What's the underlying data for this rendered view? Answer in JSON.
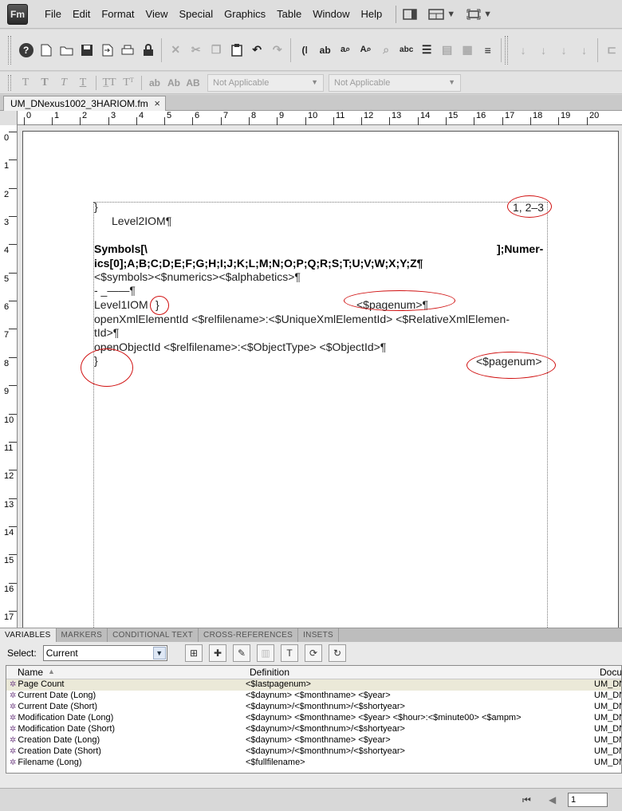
{
  "menubar": {
    "logo": "Fm",
    "items": [
      "File",
      "Edit",
      "Format",
      "View",
      "Special",
      "Graphics",
      "Table",
      "Window",
      "Help"
    ]
  },
  "toolbar2": {
    "dropdown1": "Not Applicable",
    "dropdown2": "Not Applicable"
  },
  "document_tab": {
    "filename": "UM_DNexus1002_3HARIOM.fm",
    "close": "×"
  },
  "ruler": {
    "h_labels": [
      "0",
      "1",
      "2",
      "3",
      "4",
      "5",
      "6",
      "7",
      "8",
      "9",
      "10",
      "11",
      "12",
      "13",
      "14",
      "15",
      "16",
      "17",
      "18",
      "19",
      "20"
    ],
    "v_labels": [
      "0",
      "1",
      "2",
      "3",
      "4",
      "5",
      "6",
      "7",
      "8",
      "9",
      "10",
      "11",
      "12",
      "13",
      "14",
      "15",
      "16",
      "17"
    ]
  },
  "doc": {
    "line_brace1": "}",
    "page_range": "1, 2–3",
    "level2": "Level2IOM¶",
    "symbols_left": "Symbols[\\",
    "symbols_right": "];Numer-",
    "numerics_line": "ics[0];A;B;C;D;E;F;G;H;I;J;K;L;M;N;O;P;Q;R;S;T;U;V;W;X;Y;Z¶",
    "sna_line": "<$symbols><$numerics><$alphabetics>¶",
    "dash_line": "- _——¶",
    "level1": "Level1IOM",
    "level1_brace": "}",
    "pagenum_ref": "<$pagenum>¶",
    "xml_line1": "openXmlElementId  <$relfilename>:<$UniqueXmlElementId>  <$RelativeXmlElemen-",
    "xml_line2": "tId>¶",
    "object_line": "openObjectId <$relfilename>:<$ObjectType> <$ObjectId>¶",
    "line_brace2": "}",
    "pagenum_ref2": "<$pagenum>"
  },
  "pod": {
    "tabs": [
      "VARIABLES",
      "MARKERS",
      "CONDITIONAL TEXT",
      "CROSS-REFERENCES",
      "INSETS"
    ],
    "select_label": "Select:",
    "select_value": "Current",
    "columns": [
      "Name",
      "Definition",
      "Docu"
    ],
    "rows": [
      {
        "name": "Page Count",
        "definition": "<$lastpagenum>",
        "doc": "UM_DN"
      },
      {
        "name": "Current Date (Long)",
        "definition": "<$daynum> <$monthname> <$year>",
        "doc": "UM_DN"
      },
      {
        "name": "Current Date (Short)",
        "definition": "<$daynum>/<$monthnum>/<$shortyear>",
        "doc": "UM_DN"
      },
      {
        "name": "Modification Date (Long)",
        "definition": "<$daynum> <$monthname> <$year> <$hour>:<$minute00> <$ampm>",
        "doc": "UM_DN"
      },
      {
        "name": "Modification Date (Short)",
        "definition": "<$daynum>/<$monthnum>/<$shortyear>",
        "doc": "UM_DN"
      },
      {
        "name": "Creation Date (Long)",
        "definition": "<$daynum> <$monthname> <$year>",
        "doc": "UM_DN"
      },
      {
        "name": "Creation Date (Short)",
        "definition": "<$daynum>/<$monthnum>/<$shortyear>",
        "doc": "UM_DN"
      },
      {
        "name": "Filename (Long)",
        "definition": "<$fullfilename>",
        "doc": "UM_DN"
      }
    ]
  },
  "status": {
    "page_value": "1"
  }
}
